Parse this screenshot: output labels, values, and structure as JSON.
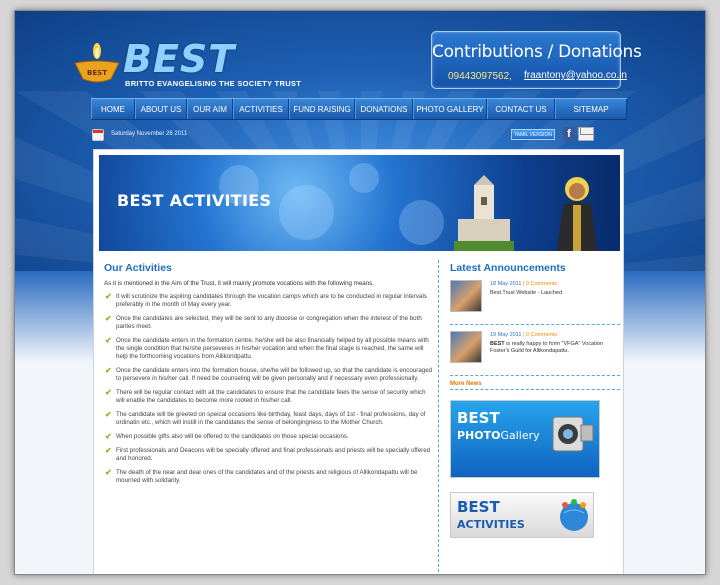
{
  "logo": {
    "title": "BEST",
    "subtitle": "BRITTO EVANGELISING THE SOCIETY TRUST",
    "lamp_text": "BEST"
  },
  "contributions": {
    "title": "Contributions / Donations",
    "phone": "09443097562,",
    "email": "fraantony@yahoo.co.in"
  },
  "nav": [
    "HOME",
    "ABOUT US",
    "OUR AIM",
    "ACTIVITIES",
    "FUND RAISING",
    "DONATIONS",
    "PHOTO GALLERY",
    "CONTACT US",
    "SITEMAP"
  ],
  "datebar": {
    "date": "Saturday November 26 2011",
    "tamil_version": "TAMIL VERSION",
    "facebook": "f"
  },
  "banner": {
    "title": "BEST ACTIVITIES"
  },
  "activities": {
    "title": "Our Activities",
    "intro": "As it is mentioned in the Aim of the Trust, it will mainly promote vocations with the following means.",
    "items": [
      "It will scrutinize the aspiring candidates through the vocation camps which are to be conducted in regular intervals preferably in the month of May every year.",
      "Once the candidates are selected, they will be sent to any diocese or congregation when the interest of the both parites meet.",
      "Once the candidate enters in the formation centre, he/she will be also financially helped by all possible means with the single condition that he/she perseveres in his/her vocation and when the final stage is reached, the same will help the forthcoming vocations from Allikondpattu.",
      "Once the candidate enters into the formation house, she/he will be followed up, so that the candidate is encouraged to persevere in his/her call. If need be counseling will be given personally and if necessary even professionally.",
      "There will be regular contact with all the candidates to ensure that the candidate feels the sense of security which will enable the candidates to become more rooted in his/her call.",
      "The candidate will be greeted on speical occasions like birthday, feast days, days of 1st - final professions, day of ordinatin etc., which will instill in the candidates the sense of belongingness to the Mother Church.",
      "When possible gifts also will be offered to the candidates on those special occasions.",
      "First professionals and Deacons will be specially offered and final professionals and priests will be specially offered and honored.",
      "The death of the near and dear ones of the candidates and of the priests and religious of Allikondapattu will be mourned with solidarity."
    ]
  },
  "announcements": {
    "title": "Latest Announcements",
    "items": [
      {
        "date": "18 May 2011",
        "sep": "|",
        "comments": "0 Comments",
        "text_bold": "",
        "text": "Best Trust Website - Lauched"
      },
      {
        "date": "19 May 2011",
        "sep": "|",
        "comments": "0 Comments",
        "text_bold": "BEST",
        "text": " is really happy to form \"VFGA\" Vocation Foster's Guild for Allikondapattu."
      }
    ],
    "more_news": "More News"
  },
  "promos": {
    "photo": {
      "line1": "BEST",
      "line2a": "PHOTO",
      "line2b": "Gallery"
    },
    "activities": {
      "line1": "BEST",
      "line2": "ACTIVITIES"
    }
  }
}
